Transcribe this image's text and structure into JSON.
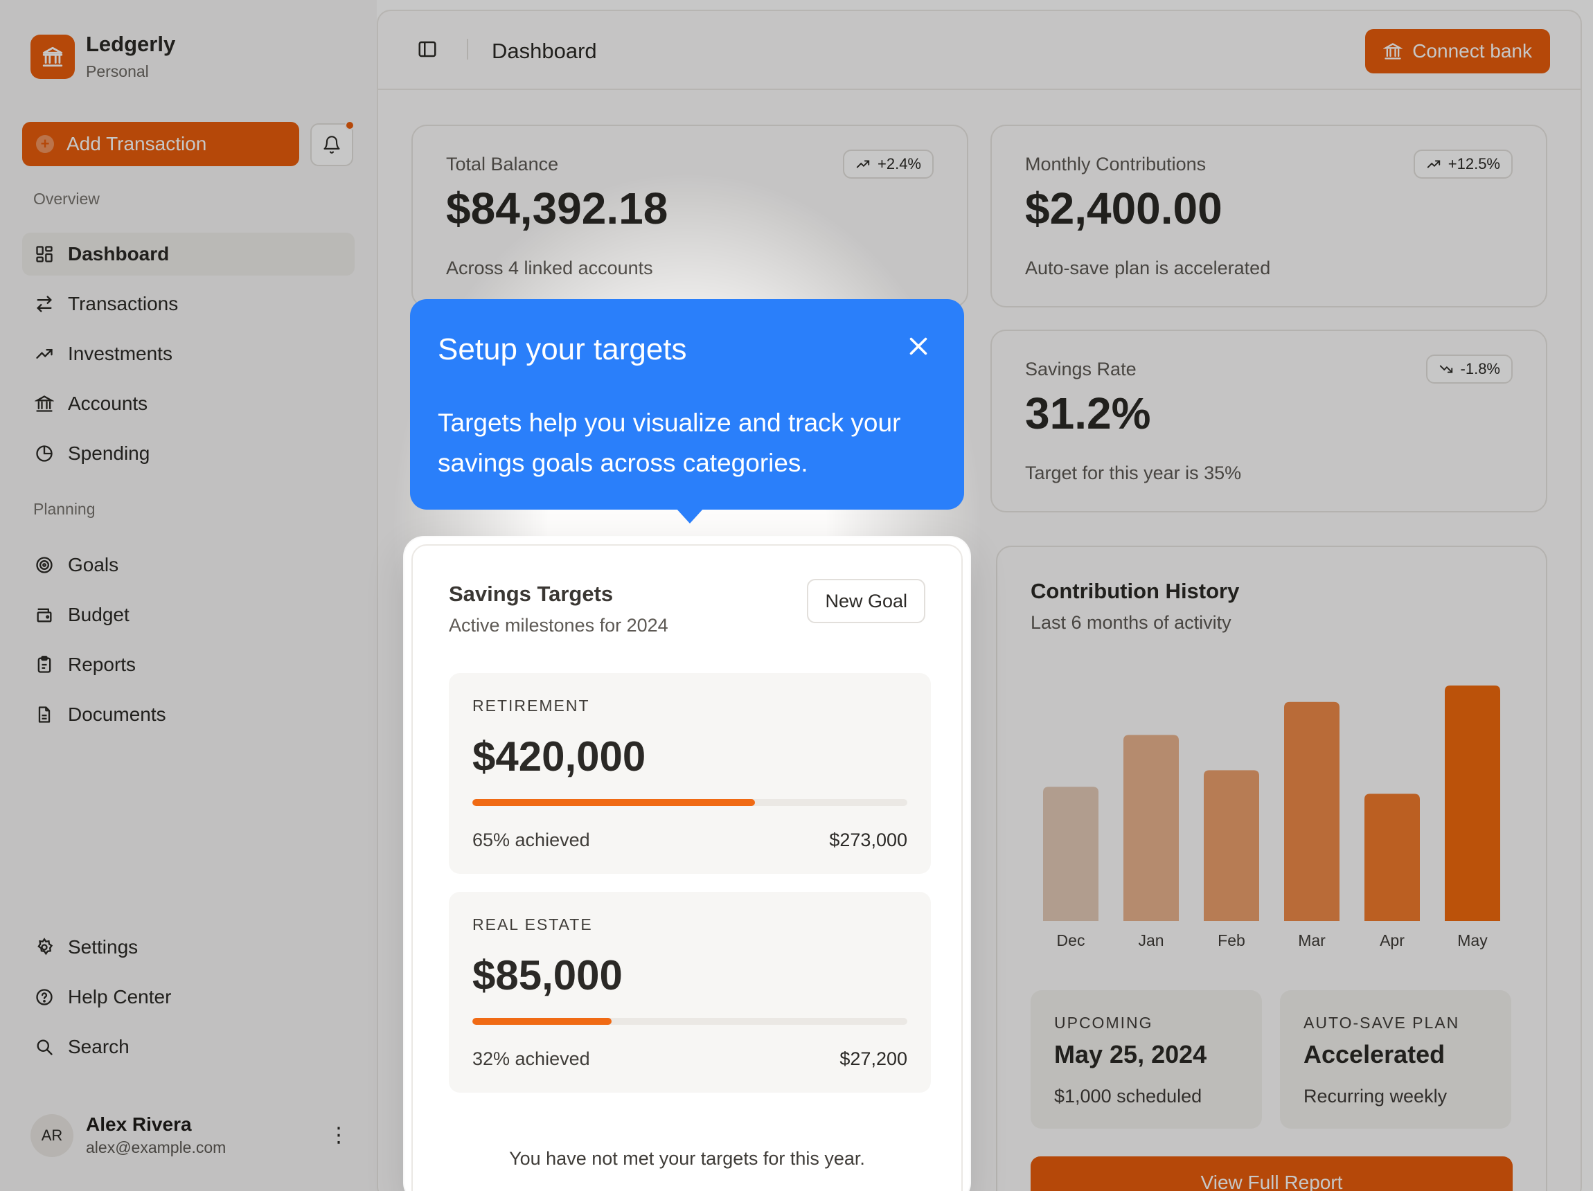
{
  "brand": {
    "name": "Ledgerly",
    "subtitle": "Personal"
  },
  "sidebar": {
    "add_transaction": "Add Transaction",
    "sections": {
      "overview": "Overview",
      "planning": "Planning"
    },
    "overview_items": [
      {
        "label": "Dashboard",
        "icon": "grid-icon",
        "active": true
      },
      {
        "label": "Transactions",
        "icon": "arrows-icon"
      },
      {
        "label": "Investments",
        "icon": "trend-up-icon"
      },
      {
        "label": "Accounts",
        "icon": "bank-icon"
      },
      {
        "label": "Spending",
        "icon": "pie-icon"
      }
    ],
    "planning_items": [
      {
        "label": "Goals",
        "icon": "target-icon"
      },
      {
        "label": "Budget",
        "icon": "wallet-icon"
      },
      {
        "label": "Reports",
        "icon": "clipboard-icon"
      },
      {
        "label": "Documents",
        "icon": "document-icon"
      }
    ],
    "footer_items": [
      {
        "label": "Settings",
        "icon": "gear-icon"
      },
      {
        "label": "Help Center",
        "icon": "help-icon"
      },
      {
        "label": "Search",
        "icon": "search-icon"
      }
    ],
    "user": {
      "initials": "AR",
      "name": "Alex Rivera",
      "email": "alex@example.com"
    }
  },
  "header": {
    "title": "Dashboard",
    "connect_bank": "Connect bank"
  },
  "stats": {
    "total_balance": {
      "label": "Total Balance",
      "value": "$84,392.18",
      "note": "Across 4 linked accounts",
      "change": "+2.4%"
    },
    "monthly_contributions": {
      "label": "Monthly Contributions",
      "value": "$2,400.00",
      "note": "Auto-save plan is accelerated",
      "change": "+12.5%"
    },
    "savings_rate": {
      "label": "Savings Rate",
      "value": "31.2%",
      "note": "Target for this year is 35%",
      "change": "-1.8%"
    }
  },
  "tooltip": {
    "title": "Setup your targets",
    "body": "Targets help you visualize and track your savings goals across categories."
  },
  "savings_targets": {
    "title": "Savings Targets",
    "subtitle": "Active milestones for 2024",
    "new_goal": "New Goal",
    "goals": [
      {
        "label": "RETIREMENT",
        "value": "$420,000",
        "progress": 0.65,
        "achieved": "65% achieved",
        "amount": "$273,000"
      },
      {
        "label": "REAL ESTATE",
        "value": "$85,000",
        "progress": 0.32,
        "achieved": "32% achieved",
        "amount": "$27,200"
      }
    ],
    "footer": "You have not met your targets for this year."
  },
  "contribution_history": {
    "title": "Contribution History",
    "subtitle": "Last 6 months of activity",
    "upcoming": {
      "label": "UPCOMING",
      "value": "May 25, 2024",
      "note": "$1,000 scheduled"
    },
    "auto_save": {
      "label": "AUTO-SAVE PLAN",
      "value": "Accelerated",
      "note": "Recurring weekly"
    },
    "report_button": "View Full Report"
  },
  "chart_data": {
    "type": "bar",
    "categories": [
      "Dec",
      "Jan",
      "Feb",
      "Mar",
      "Apr",
      "May"
    ],
    "values": [
      57,
      79,
      64,
      93,
      54,
      100
    ],
    "ylim": [
      0,
      100
    ],
    "grid": false,
    "colors": [
      "#e3c9b7",
      "#e8b28e",
      "#eb9f6c",
      "#ed8a48",
      "#f07a2c",
      "#f06a0e"
    ]
  }
}
